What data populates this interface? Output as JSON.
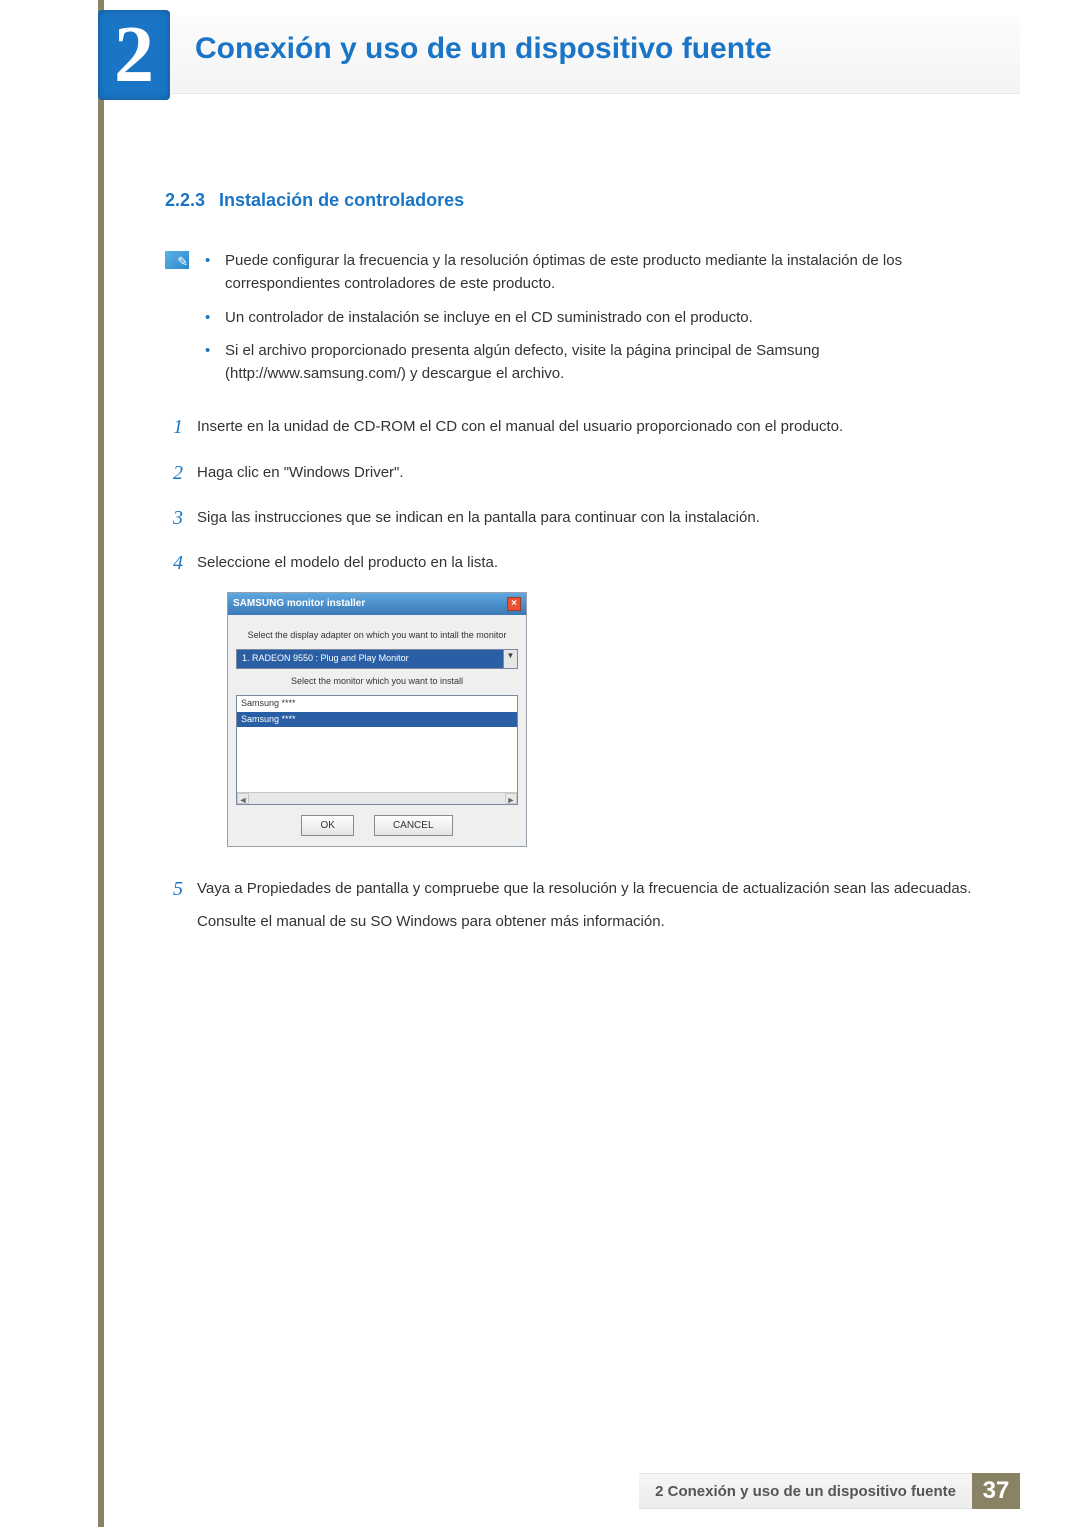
{
  "chapter": {
    "number": "2",
    "title": "Conexión y uso de un dispositivo fuente"
  },
  "section": {
    "number": "2.2.3",
    "title": "Instalación de controladores"
  },
  "notes": [
    "Puede configurar la frecuencia y la resolución óptimas de este producto mediante la instalación de los correspondientes controladores de este producto.",
    "Un controlador de instalación se incluye en el CD suministrado con el producto.",
    "Si el archivo proporcionado presenta algún defecto, visite la página principal de Samsung (http://www.samsung.com/) y descargue el archivo."
  ],
  "steps": [
    {
      "n": "1",
      "text": "Inserte en la unidad de CD-ROM el CD con el manual del usuario proporcionado con el producto."
    },
    {
      "n": "2",
      "text": "Haga clic en \"Windows Driver\"."
    },
    {
      "n": "3",
      "text": "Siga las instrucciones que se indican en la pantalla para continuar con la instalación."
    },
    {
      "n": "4",
      "text": "Seleccione el modelo del producto en la lista."
    },
    {
      "n": "5",
      "text": "Vaya a Propiedades de pantalla y compruebe que la resolución y la frecuencia de actualización sean las adecuadas.",
      "extra": "Consulte el manual de su SO Windows para obtener más información."
    }
  ],
  "dialog": {
    "title": "SAMSUNG monitor installer",
    "label1": "Select the display adapter on which you want to intall the monitor",
    "select_value": "1. RADEON 9550 : Plug and Play Monitor",
    "label2": "Select the monitor which you want to install",
    "list": [
      "Samsung ****",
      "Samsung ****"
    ],
    "ok": "OK",
    "cancel": "CANCEL"
  },
  "footer": {
    "text": "2 Conexión y uso de un dispositivo fuente",
    "page": "37"
  }
}
